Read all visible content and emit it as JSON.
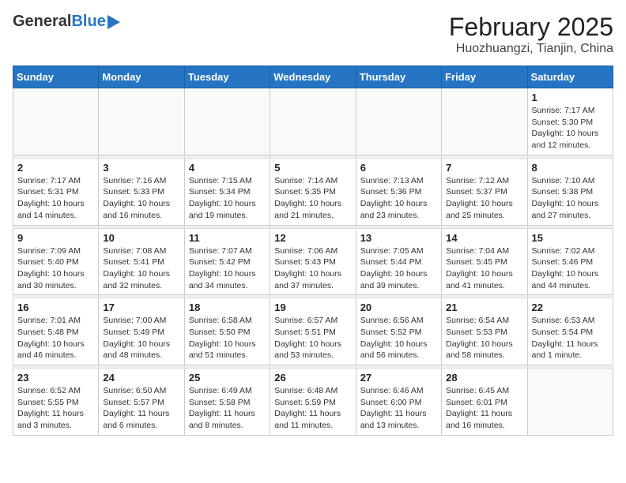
{
  "header": {
    "logo_general": "General",
    "logo_blue": "Blue",
    "title": "February 2025",
    "subtitle": "Huozhuangzi, Tianjin, China"
  },
  "weekdays": [
    "Sunday",
    "Monday",
    "Tuesday",
    "Wednesday",
    "Thursday",
    "Friday",
    "Saturday"
  ],
  "weeks": [
    [
      {
        "day": "",
        "info": ""
      },
      {
        "day": "",
        "info": ""
      },
      {
        "day": "",
        "info": ""
      },
      {
        "day": "",
        "info": ""
      },
      {
        "day": "",
        "info": ""
      },
      {
        "day": "",
        "info": ""
      },
      {
        "day": "1",
        "info": "Sunrise: 7:17 AM\nSunset: 5:30 PM\nDaylight: 10 hours and 12 minutes."
      }
    ],
    [
      {
        "day": "2",
        "info": "Sunrise: 7:17 AM\nSunset: 5:31 PM\nDaylight: 10 hours and 14 minutes."
      },
      {
        "day": "3",
        "info": "Sunrise: 7:16 AM\nSunset: 5:33 PM\nDaylight: 10 hours and 16 minutes."
      },
      {
        "day": "4",
        "info": "Sunrise: 7:15 AM\nSunset: 5:34 PM\nDaylight: 10 hours and 19 minutes."
      },
      {
        "day": "5",
        "info": "Sunrise: 7:14 AM\nSunset: 5:35 PM\nDaylight: 10 hours and 21 minutes."
      },
      {
        "day": "6",
        "info": "Sunrise: 7:13 AM\nSunset: 5:36 PM\nDaylight: 10 hours and 23 minutes."
      },
      {
        "day": "7",
        "info": "Sunrise: 7:12 AM\nSunset: 5:37 PM\nDaylight: 10 hours and 25 minutes."
      },
      {
        "day": "8",
        "info": "Sunrise: 7:10 AM\nSunset: 5:38 PM\nDaylight: 10 hours and 27 minutes."
      }
    ],
    [
      {
        "day": "9",
        "info": "Sunrise: 7:09 AM\nSunset: 5:40 PM\nDaylight: 10 hours and 30 minutes."
      },
      {
        "day": "10",
        "info": "Sunrise: 7:08 AM\nSunset: 5:41 PM\nDaylight: 10 hours and 32 minutes."
      },
      {
        "day": "11",
        "info": "Sunrise: 7:07 AM\nSunset: 5:42 PM\nDaylight: 10 hours and 34 minutes."
      },
      {
        "day": "12",
        "info": "Sunrise: 7:06 AM\nSunset: 5:43 PM\nDaylight: 10 hours and 37 minutes."
      },
      {
        "day": "13",
        "info": "Sunrise: 7:05 AM\nSunset: 5:44 PM\nDaylight: 10 hours and 39 minutes."
      },
      {
        "day": "14",
        "info": "Sunrise: 7:04 AM\nSunset: 5:45 PM\nDaylight: 10 hours and 41 minutes."
      },
      {
        "day": "15",
        "info": "Sunrise: 7:02 AM\nSunset: 5:46 PM\nDaylight: 10 hours and 44 minutes."
      }
    ],
    [
      {
        "day": "16",
        "info": "Sunrise: 7:01 AM\nSunset: 5:48 PM\nDaylight: 10 hours and 46 minutes."
      },
      {
        "day": "17",
        "info": "Sunrise: 7:00 AM\nSunset: 5:49 PM\nDaylight: 10 hours and 48 minutes."
      },
      {
        "day": "18",
        "info": "Sunrise: 6:58 AM\nSunset: 5:50 PM\nDaylight: 10 hours and 51 minutes."
      },
      {
        "day": "19",
        "info": "Sunrise: 6:57 AM\nSunset: 5:51 PM\nDaylight: 10 hours and 53 minutes."
      },
      {
        "day": "20",
        "info": "Sunrise: 6:56 AM\nSunset: 5:52 PM\nDaylight: 10 hours and 56 minutes."
      },
      {
        "day": "21",
        "info": "Sunrise: 6:54 AM\nSunset: 5:53 PM\nDaylight: 10 hours and 58 minutes."
      },
      {
        "day": "22",
        "info": "Sunrise: 6:53 AM\nSunset: 5:54 PM\nDaylight: 11 hours and 1 minute."
      }
    ],
    [
      {
        "day": "23",
        "info": "Sunrise: 6:52 AM\nSunset: 5:55 PM\nDaylight: 11 hours and 3 minutes."
      },
      {
        "day": "24",
        "info": "Sunrise: 6:50 AM\nSunset: 5:57 PM\nDaylight: 11 hours and 6 minutes."
      },
      {
        "day": "25",
        "info": "Sunrise: 6:49 AM\nSunset: 5:58 PM\nDaylight: 11 hours and 8 minutes."
      },
      {
        "day": "26",
        "info": "Sunrise: 6:48 AM\nSunset: 5:59 PM\nDaylight: 11 hours and 11 minutes."
      },
      {
        "day": "27",
        "info": "Sunrise: 6:46 AM\nSunset: 6:00 PM\nDaylight: 11 hours and 13 minutes."
      },
      {
        "day": "28",
        "info": "Sunrise: 6:45 AM\nSunset: 6:01 PM\nDaylight: 11 hours and 16 minutes."
      },
      {
        "day": "",
        "info": ""
      }
    ]
  ]
}
